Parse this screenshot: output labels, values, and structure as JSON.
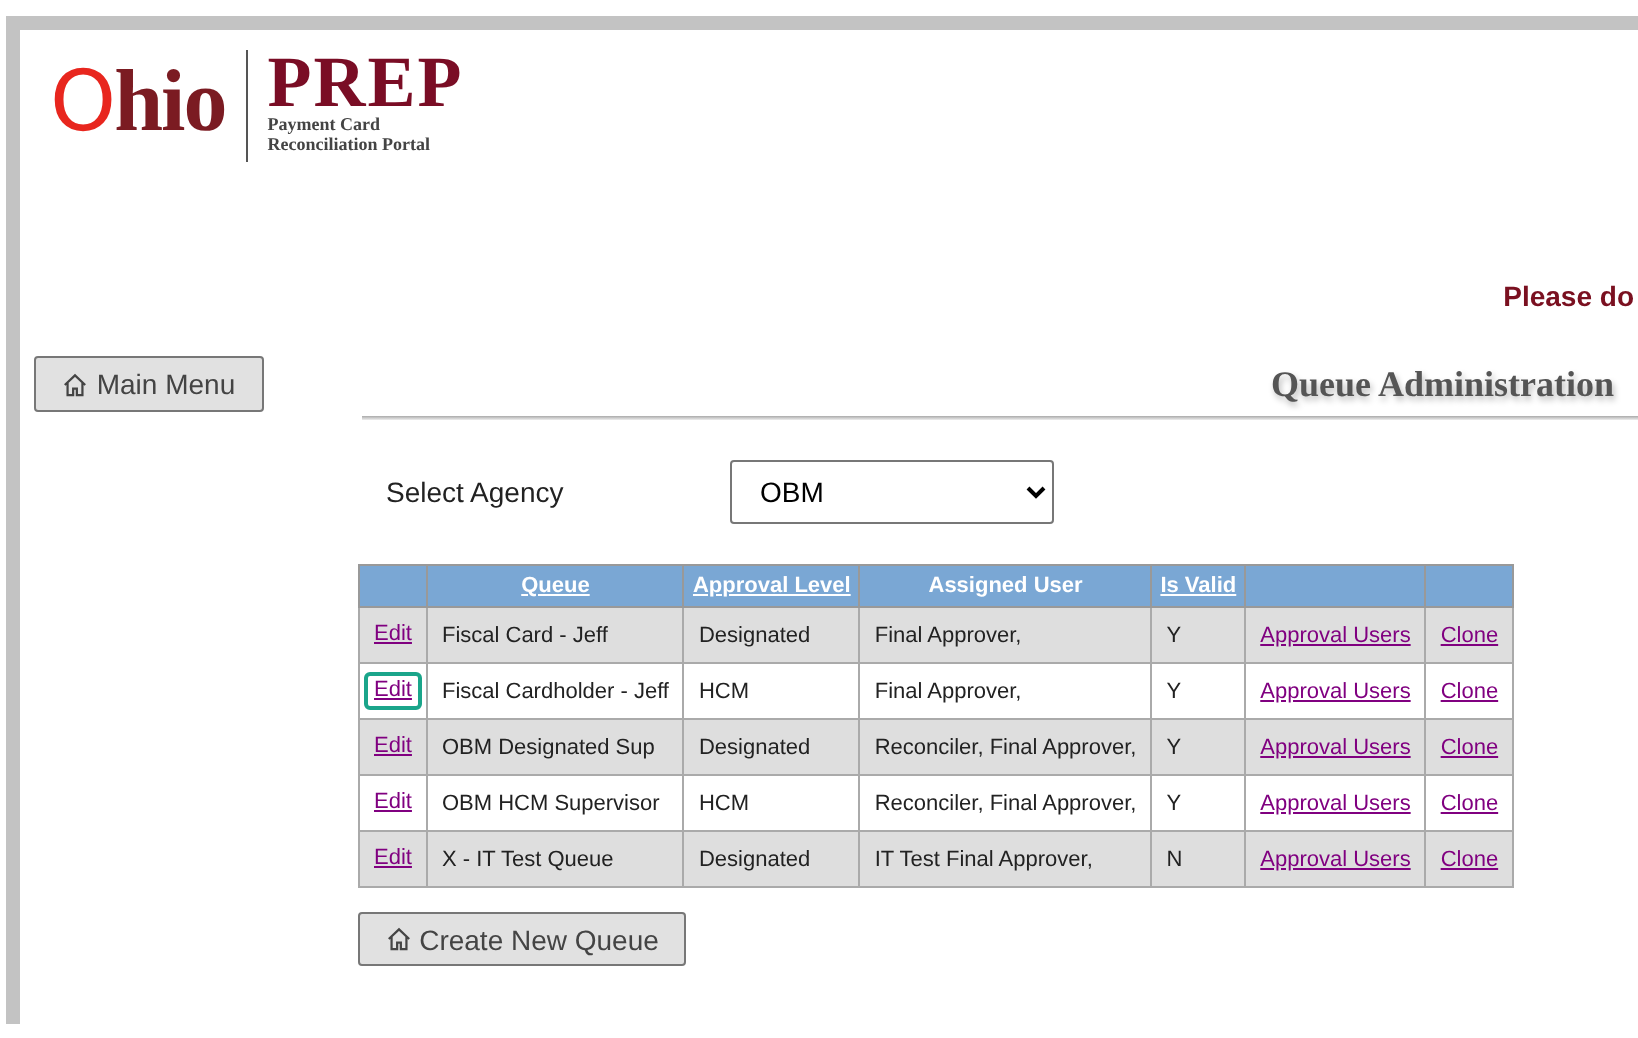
{
  "logo": {
    "state_name": "Ohio",
    "app_name": "PREP",
    "tagline_lines": [
      "Payment Card",
      "Reconciliation Portal"
    ]
  },
  "notice": "Please do",
  "main_menu_button": "Main Menu",
  "page_title": "Queue Administration",
  "agency_filter": {
    "label": "Select Agency",
    "value": "OBM"
  },
  "table": {
    "columns": [
      {
        "kind": "blank"
      },
      {
        "kind": "label",
        "label": "Queue",
        "sortable": true
      },
      {
        "kind": "label",
        "label": "Approval Level",
        "sortable": true
      },
      {
        "kind": "label",
        "label": "Assigned User",
        "sortable": false
      },
      {
        "kind": "label",
        "label": "Is Valid",
        "sortable": true
      },
      {
        "kind": "blank"
      },
      {
        "kind": "blank"
      }
    ],
    "rows": [
      {
        "edit": "Edit",
        "queue": "Fiscal Card - Jeff",
        "approval_level": "Designated",
        "assigned_user": "Final Approver,",
        "is_valid": "Y",
        "approval_users": "Approval Users",
        "clone": "Clone",
        "highlighted": false
      },
      {
        "edit": "Edit",
        "queue": "Fiscal Cardholder - Jeff",
        "approval_level": "HCM",
        "assigned_user": "Final Approver,",
        "is_valid": "Y",
        "approval_users": "Approval Users",
        "clone": "Clone",
        "highlighted": true
      },
      {
        "edit": "Edit",
        "queue": "OBM Designated Sup",
        "approval_level": "Designated",
        "assigned_user": "Reconciler, Final Approver,",
        "is_valid": "Y",
        "approval_users": "Approval Users",
        "clone": "Clone",
        "highlighted": false
      },
      {
        "edit": "Edit",
        "queue": "OBM HCM Supervisor",
        "approval_level": "HCM",
        "assigned_user": "Reconciler, Final Approver,",
        "is_valid": "Y",
        "approval_users": "Approval Users",
        "clone": "Clone",
        "highlighted": false
      },
      {
        "edit": "Edit",
        "queue": "X - IT Test Queue",
        "approval_level": "Designated",
        "assigned_user": "IT Test Final Approver,",
        "is_valid": "N",
        "approval_users": "Approval Users",
        "clone": "Clone",
        "highlighted": false
      }
    ]
  },
  "create_button": "Create New Queue"
}
